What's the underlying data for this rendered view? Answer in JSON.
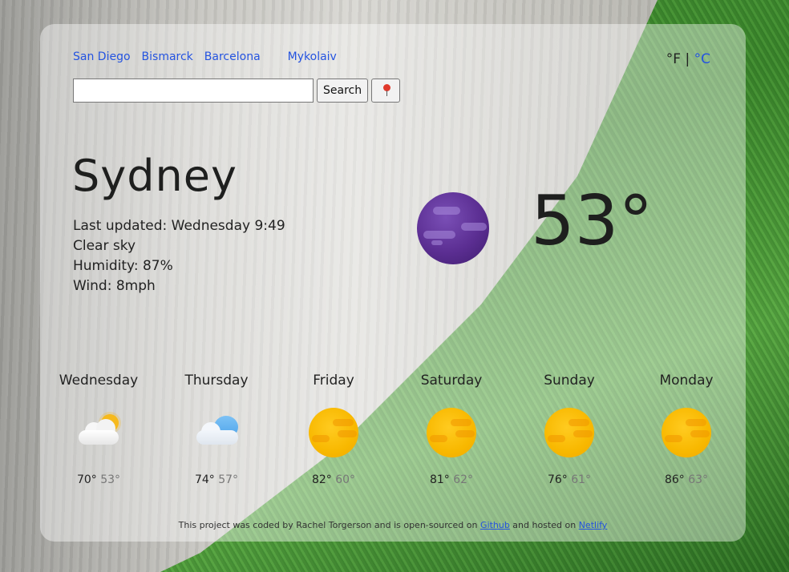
{
  "quick_cities": [
    "San Diego",
    "Bismarck",
    "Barcelona",
    "Mykolaiv"
  ],
  "units": {
    "fahrenheit": "°F",
    "separator": "|",
    "celsius": "°C"
  },
  "search": {
    "placeholder": "",
    "button_label": "Search",
    "location_icon": "pin-icon"
  },
  "current": {
    "city": "Sydney",
    "last_updated": "Last updated: Wednesday 9:49",
    "description": "Clear sky",
    "humidity": "Humidity: 87%",
    "wind": "Wind: 8mph",
    "temperature": "53°",
    "icon": "clear-night-icon"
  },
  "forecast": [
    {
      "day": "Wednesday",
      "max": "70°",
      "min": "53°",
      "icon": "partly-cloudy-icon"
    },
    {
      "day": "Thursday",
      "max": "74°",
      "min": "57°",
      "icon": "cloudy-icon"
    },
    {
      "day": "Friday",
      "max": "82°",
      "min": "60°",
      "icon": "sunny-icon"
    },
    {
      "day": "Saturday",
      "max": "81°",
      "min": "62°",
      "icon": "sunny-icon"
    },
    {
      "day": "Sunday",
      "max": "76°",
      "min": "61°",
      "icon": "sunny-icon"
    },
    {
      "day": "Monday",
      "max": "86°",
      "min": "63°",
      "icon": "sunny-icon"
    }
  ],
  "footer": {
    "text_before": "This project was coded by Rachel Torgerson and is open-sourced on ",
    "github_link": "Github",
    "text_middle": " and hosted on ",
    "netlify_link": "Netlify"
  },
  "colors": {
    "link": "#2453e0",
    "current_icon": "#5b2e92",
    "sun": "#f8b800"
  }
}
